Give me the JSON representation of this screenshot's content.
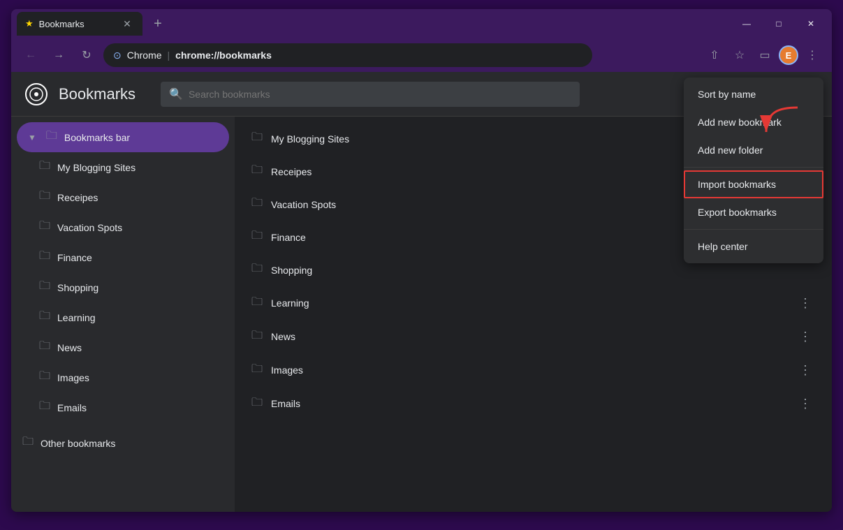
{
  "browser": {
    "tab_title": "Bookmarks",
    "tab_favicon": "★",
    "address_site": "Chrome",
    "address_url": "chrome://bookmarks",
    "profile_initial": "E"
  },
  "bookmarks_page": {
    "title": "Bookmarks",
    "search_placeholder": "Search bookmarks"
  },
  "sidebar": {
    "bookmarks_bar_label": "Bookmarks bar",
    "other_bookmarks_label": "Other bookmarks",
    "children": [
      {
        "label": "My Blogging Sites"
      },
      {
        "label": "Receipes"
      },
      {
        "label": "Vacation Spots"
      },
      {
        "label": "Finance"
      },
      {
        "label": "Shopping"
      },
      {
        "label": "Learning"
      },
      {
        "label": "News"
      },
      {
        "label": "Images"
      },
      {
        "label": "Emails"
      }
    ]
  },
  "bookmark_list": {
    "items": [
      {
        "name": "My Blogging Sites",
        "show_more": false
      },
      {
        "name": "Receipes",
        "show_more": false
      },
      {
        "name": "Vacation Spots",
        "show_more": false
      },
      {
        "name": "Finance",
        "show_more": false
      },
      {
        "name": "Shopping",
        "show_more": false
      },
      {
        "name": "Learning",
        "show_more": true
      },
      {
        "name": "News",
        "show_more": true
      },
      {
        "name": "Images",
        "show_more": true
      },
      {
        "name": "Emails",
        "show_more": true
      }
    ]
  },
  "context_menu": {
    "items": [
      {
        "label": "Sort by name",
        "highlighted": false,
        "divider_after": false
      },
      {
        "label": "Add new bookmark",
        "highlighted": false,
        "divider_after": false
      },
      {
        "label": "Add new folder",
        "highlighted": false,
        "divider_after": true
      },
      {
        "label": "Import bookmarks",
        "highlighted": true,
        "divider_after": false
      },
      {
        "label": "Export bookmarks",
        "highlighted": false,
        "divider_after": true
      },
      {
        "label": "Help center",
        "highlighted": false,
        "divider_after": false
      }
    ]
  },
  "window_controls": {
    "minimize": "—",
    "maximize": "□",
    "close": "✕"
  }
}
